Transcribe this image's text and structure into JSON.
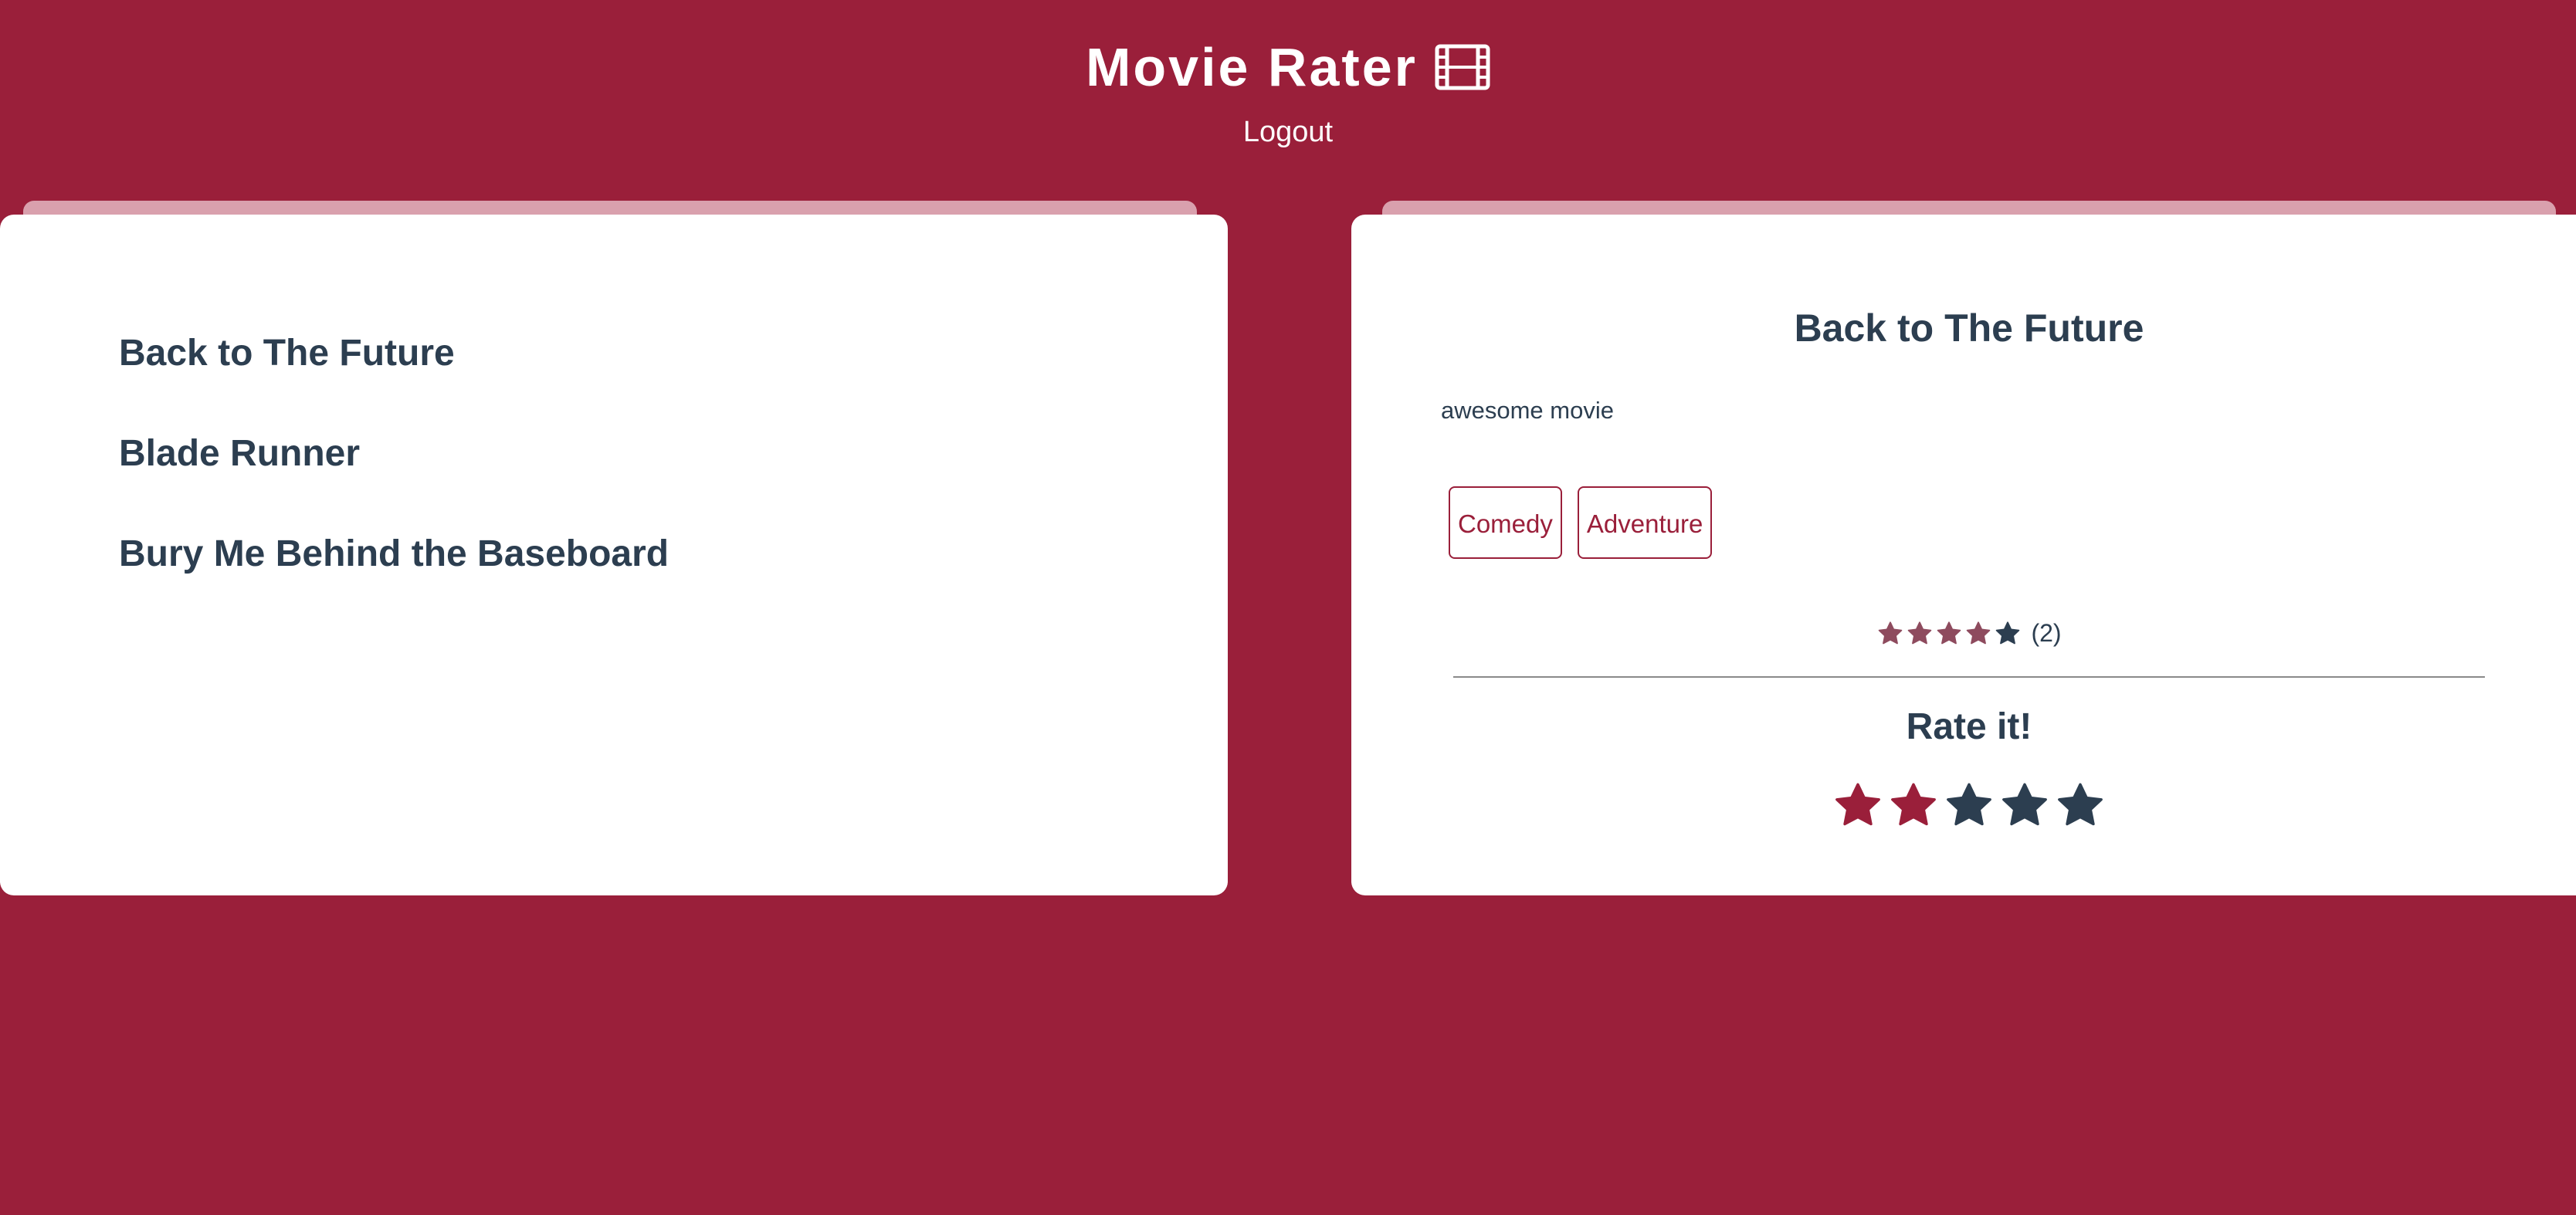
{
  "header": {
    "title": "Movie Rater",
    "title_icon": "film-icon",
    "logout_label": "Logout"
  },
  "movie_list": {
    "items": [
      {
        "title": "Back to The Future"
      },
      {
        "title": "Blade Runner"
      },
      {
        "title": "Bury Me Behind the Baseboard"
      }
    ]
  },
  "movie_detail": {
    "title": "Back to The Future",
    "description": "awesome movie",
    "genres": [
      "Comedy",
      "Adventure"
    ],
    "average_rating": {
      "filled_stars": 4,
      "total_stars": 5,
      "count_label": "(2)"
    },
    "rate_section": {
      "heading": "Rate it!",
      "selected_stars": 2,
      "total_stars": 5
    }
  },
  "colors": {
    "background": "#9a1f3a",
    "accent": "#9a1f3a",
    "text_dark": "#2c3e50",
    "avg_star_filled": "#8e4b5e",
    "star_empty": "#2c3e50",
    "tab_strip": "#d9a0ad"
  }
}
